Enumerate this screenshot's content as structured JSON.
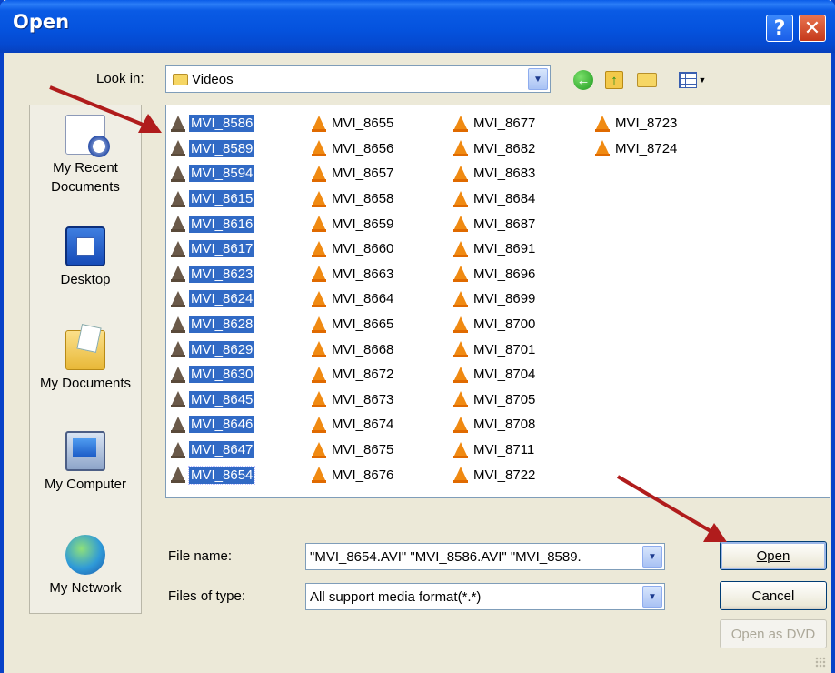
{
  "window": {
    "title": "Open"
  },
  "toolbar": {
    "look_in_label": "Look in:",
    "look_in_value": "Videos"
  },
  "places": [
    {
      "label": "My Recent\nDocuments",
      "icon": "recent-documents-icon"
    },
    {
      "label": "Desktop",
      "icon": "desktop-icon"
    },
    {
      "label": "My Documents",
      "icon": "my-documents-icon"
    },
    {
      "label": "My Computer",
      "icon": "my-computer-icon"
    },
    {
      "label": "My Network",
      "icon": "my-network-icon"
    }
  ],
  "files": {
    "columns": [
      [
        "MVI_8586",
        "MVI_8589",
        "MVI_8594",
        "MVI_8615",
        "MVI_8616",
        "MVI_8617",
        "MVI_8623",
        "MVI_8624",
        "MVI_8628",
        "MVI_8629",
        "MVI_8630",
        "MVI_8645",
        "MVI_8646",
        "MVI_8647",
        "MVI_8654"
      ],
      [
        "MVI_8655",
        "MVI_8656",
        "MVI_8657",
        "MVI_8658",
        "MVI_8659",
        "MVI_8660",
        "MVI_8663",
        "MVI_8664",
        "MVI_8665",
        "MVI_8668",
        "MVI_8672",
        "MVI_8673",
        "MVI_8674",
        "MVI_8675",
        "MVI_8676"
      ],
      [
        "MVI_8677",
        "MVI_8682",
        "MVI_8683",
        "MVI_8684",
        "MVI_8687",
        "MVI_8691",
        "MVI_8696",
        "MVI_8699",
        "MVI_8700",
        "MVI_8701",
        "MVI_8704",
        "MVI_8705",
        "MVI_8708",
        "MVI_8711",
        "MVI_8722"
      ],
      [
        "MVI_8723",
        "MVI_8724"
      ]
    ],
    "selected_column": 0,
    "focused": "MVI_8654",
    "icon": "vlc-cone-icon"
  },
  "form": {
    "file_name_label": "File name:",
    "file_name_value": "\"MVI_8654.AVI\" \"MVI_8586.AVI\" \"MVI_8589.",
    "file_type_label": "Files of type:",
    "file_type_value": "All support media format(*.*)"
  },
  "buttons": {
    "open": "Open",
    "cancel": "Cancel",
    "open_dvd": "Open as DVD",
    "help": "?",
    "close": "✕"
  },
  "colors": {
    "title_bar": "#0553de",
    "selection": "#316ac5",
    "annotation_arrow": "#b01c1c",
    "cone": "#f08a12"
  }
}
